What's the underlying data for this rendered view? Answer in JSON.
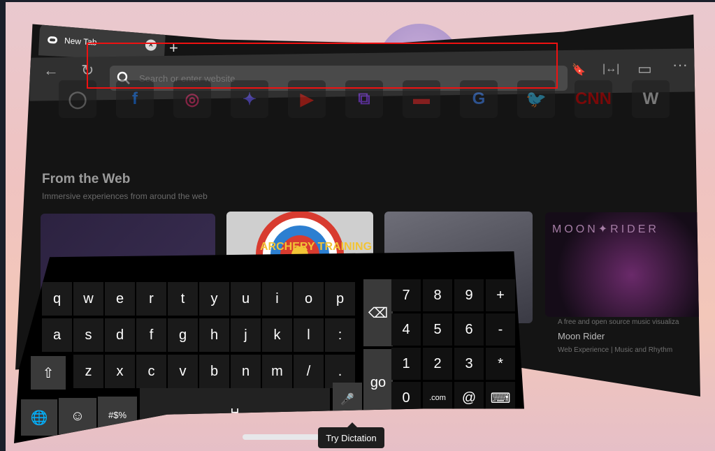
{
  "tab": {
    "title": "New Tab",
    "close": "×",
    "new_tab": "+"
  },
  "toolbar": {
    "back": "←",
    "reload": "↻",
    "search_placeholder": "Search or enter website",
    "bookmark": "🔖",
    "fit": "|↔|",
    "cast": "▭",
    "more": "···"
  },
  "favorites": [
    {
      "name": "Oculus",
      "glyph": "◯",
      "color": "#888888"
    },
    {
      "name": "Facebook",
      "glyph": "f",
      "color": "#1877f2"
    },
    {
      "name": "Instagram",
      "glyph": "◎",
      "color": "#e1306c"
    },
    {
      "name": "Messenger",
      "glyph": "✦",
      "color": "#6c5cff"
    },
    {
      "name": "YouTube",
      "glyph": "▶",
      "color": "#e62117"
    },
    {
      "name": "Twitch",
      "glyph": "⧉",
      "color": "#9146ff"
    },
    {
      "name": "Flipboard",
      "glyph": "▬",
      "color": "#e12828"
    },
    {
      "name": "Google",
      "glyph": "G",
      "color": "#4285f4"
    },
    {
      "name": "Twitter",
      "glyph": "🐦",
      "color": "#1da1f2"
    },
    {
      "name": "CNN",
      "glyph": "CNN",
      "color": "#cc0000"
    },
    {
      "name": "Wikipedia",
      "glyph": "W",
      "color": "#cccccc"
    }
  ],
  "section": {
    "title": "From the Web",
    "subtitle": "Immersive experiences from around the web"
  },
  "cards": [
    {
      "art": ""
    },
    {
      "art": "ARCHERY TRAINING"
    },
    {
      "art": ""
    },
    {
      "art": "MOON✦RIDER",
      "desc": "A free and open source music visualiza",
      "title": "Moon Rider",
      "meta": "Web Experience | Music and Rhythm"
    }
  ],
  "keyboard": {
    "row1": [
      "q",
      "w",
      "e",
      "r",
      "t",
      "y",
      "u",
      "i",
      "o",
      "p"
    ],
    "row2": [
      "a",
      "s",
      "d",
      "f",
      "g",
      "h",
      "j",
      "k",
      "l",
      ":"
    ],
    "row3": [
      "z",
      "x",
      "c",
      "v",
      "b",
      "n",
      "m",
      "/",
      "."
    ],
    "shift": "⇧",
    "backspace": "⌫",
    "go": "go",
    "globe": "🌐",
    "emoji": "☺",
    "symbols": "#$%",
    "space": "␣",
    "mic": "🎤",
    "numpad": [
      "7",
      "8",
      "9",
      "+",
      "4",
      "5",
      "6",
      "-",
      "1",
      "2",
      "3",
      "*",
      "0",
      ".com",
      "@",
      "⌨"
    ]
  },
  "tooltip": "Try Dictation"
}
